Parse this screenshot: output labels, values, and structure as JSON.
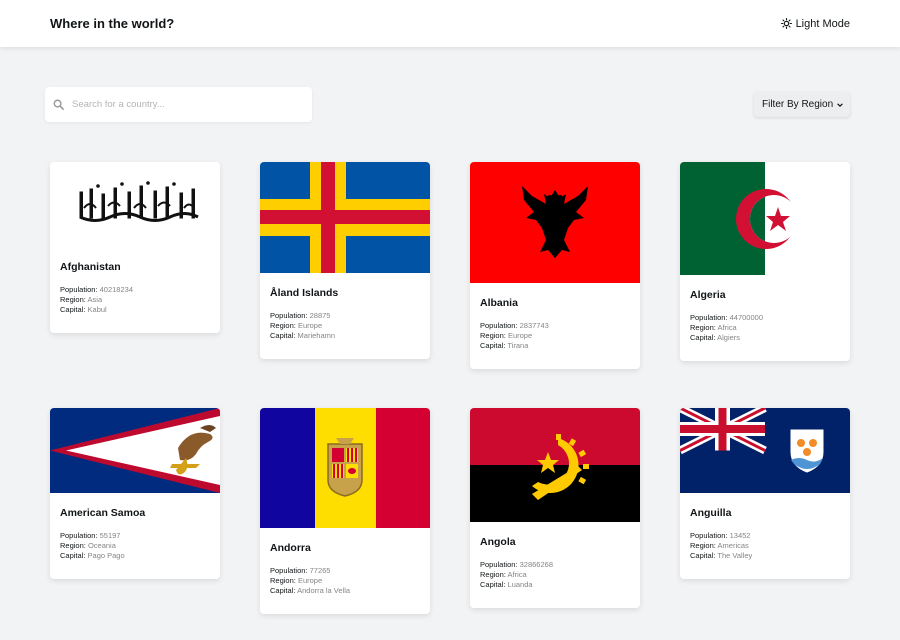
{
  "header": {
    "title": "Where in the world?",
    "mode_label": "Light Mode"
  },
  "search": {
    "placeholder": "Search for a country...",
    "value": ""
  },
  "filter": {
    "label": "Filter By Region"
  },
  "labels": {
    "population": "Population:",
    "region": "Region:",
    "capital": "Capital:"
  },
  "countries": [
    {
      "name": "Afghanistan",
      "population": "40218234",
      "region": "Asia",
      "capital": "Kabul"
    },
    {
      "name": "Åland Islands",
      "population": "28875",
      "region": "Europe",
      "capital": "Mariehamn"
    },
    {
      "name": "Albania",
      "population": "2837743",
      "region": "Europe",
      "capital": "Tirana"
    },
    {
      "name": "Algeria",
      "population": "44700000",
      "region": "Africa",
      "capital": "Algiers"
    },
    {
      "name": "American Samoa",
      "population": "55197",
      "region": "Oceania",
      "capital": "Pago Pago"
    },
    {
      "name": "Andorra",
      "population": "77265",
      "region": "Europe",
      "capital": "Andorra la Vella"
    },
    {
      "name": "Angola",
      "population": "32866268",
      "region": "Africa",
      "capital": "Luanda"
    },
    {
      "name": "Anguilla",
      "population": "13452",
      "region": "Americas",
      "capital": "The Valley"
    }
  ],
  "colors": {
    "background": "#f2f3f5",
    "card": "#ffffff",
    "text": "#111517",
    "muted": "#858585"
  },
  "icons": {
    "theme": "sun-icon",
    "search": "search-icon",
    "filter": "chevron-down-icon"
  }
}
